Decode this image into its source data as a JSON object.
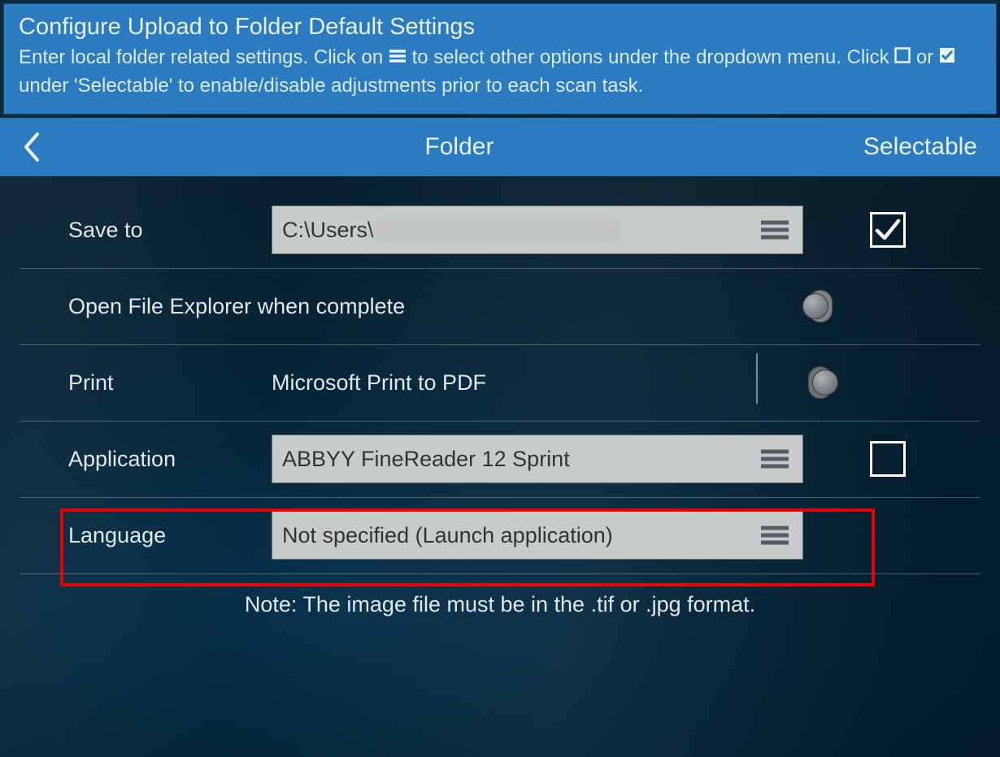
{
  "header": {
    "title": "Configure Upload to Folder Default Settings",
    "desc_part1": "Enter local folder related settings. Click on ",
    "desc_part2": " to select other options under the dropdown menu. Click ",
    "desc_part3": " or ",
    "desc_part4": " under 'Selectable' to enable/disable adjustments prior to each scan task."
  },
  "titlebar": {
    "title": "Folder",
    "right_label": "Selectable"
  },
  "rows": {
    "save_to": {
      "label": "Save to",
      "value_prefix": "C:\\Users\\",
      "selectable_checked": true
    },
    "open_explorer": {
      "label": "Open File Explorer when complete",
      "toggle_on": true
    },
    "print": {
      "label": "Print",
      "value": "Microsoft Print to PDF",
      "toggle_on": false
    },
    "application": {
      "label": "Application",
      "value": "ABBYY FineReader 12 Sprint",
      "selectable_checked": false
    },
    "language": {
      "label": "Language",
      "value": "Not specified (Launch application)"
    }
  },
  "footer_note": "Note: The image file must be in the .tif or .jpg format."
}
